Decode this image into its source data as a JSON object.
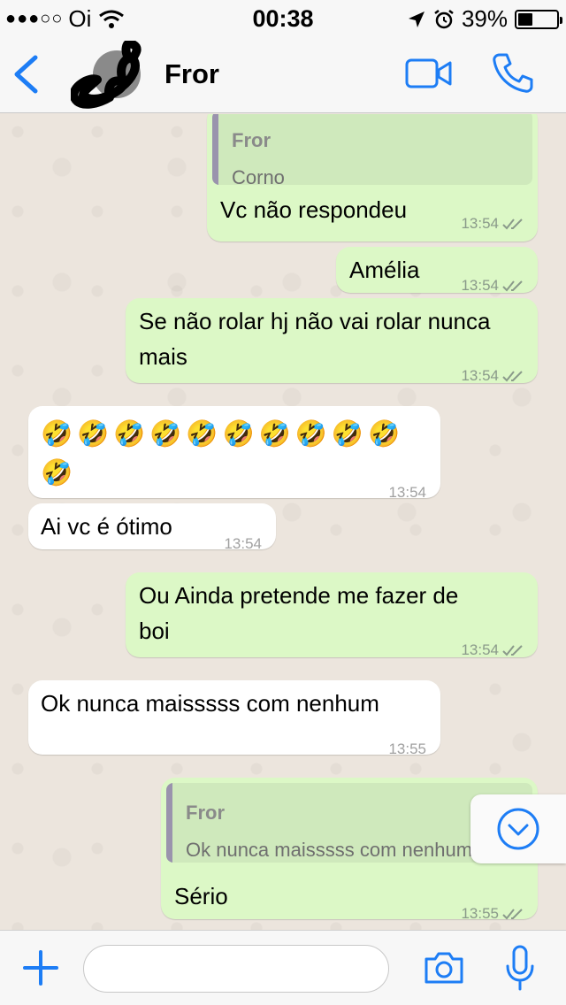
{
  "status_bar": {
    "signal_dots": "●●●○○",
    "carrier": "Oi",
    "time": "00:38",
    "battery_percent": "39%",
    "battery_level": 0.39
  },
  "header": {
    "contact_name": "Fror",
    "icons": [
      "back-chevron",
      "avatar",
      "video-call",
      "voice-call"
    ]
  },
  "accent_color": "#1d7df5",
  "messages": [
    {
      "direction": "out",
      "quote_author": "Fror",
      "quote_text": "Corno",
      "text": "Vc não respondeu",
      "time": "13:54"
    },
    {
      "direction": "out",
      "text": "Amélia",
      "time": "13:54"
    },
    {
      "direction": "out",
      "line1": "Se não rolar hj não vai rolar nunca",
      "line2": "mais",
      "time": "13:54"
    },
    {
      "direction": "in",
      "line1": "🤣🤣🤣🤣🤣🤣🤣🤣🤣🤣",
      "line2": "🤣",
      "time": "13:54"
    },
    {
      "direction": "in",
      "text": "Ai vc é ótimo",
      "time": "13:54"
    },
    {
      "direction": "out",
      "line1": "Ou Ainda pretende me fazer de",
      "line2": "boi",
      "time": "13:54"
    },
    {
      "direction": "in",
      "text": "Ok nunca maisssss com nenhum",
      "time": "13:55"
    },
    {
      "direction": "out",
      "quote_author": "Fror",
      "quote_text": "Ok nunca maisssss com nenhum",
      "text": "Sério",
      "time": "13:55"
    }
  ],
  "composer": {
    "placeholder": ""
  }
}
